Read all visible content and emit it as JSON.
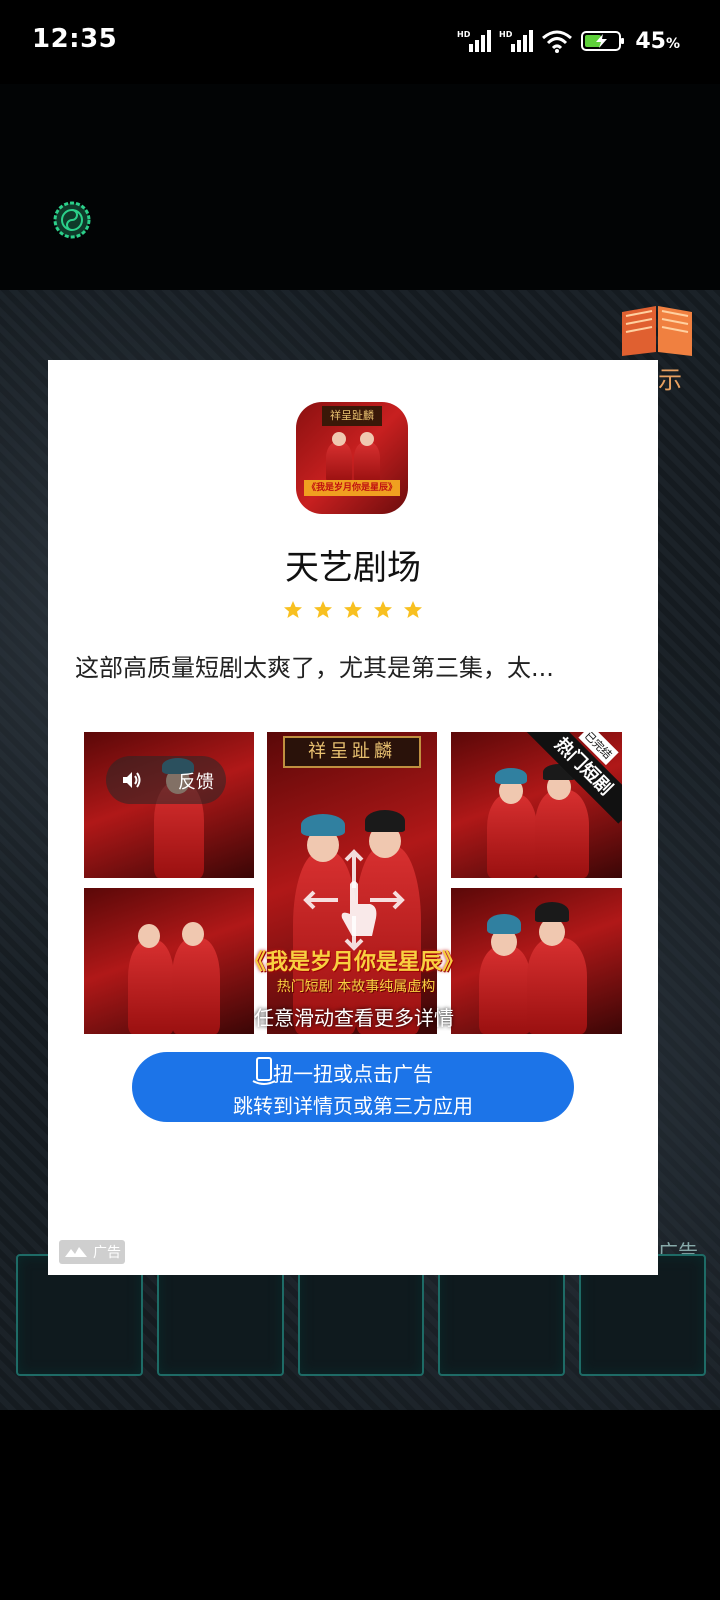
{
  "status_bar": {
    "time": "12:35",
    "battery_percent": "45",
    "battery_unit": "%",
    "signal_labels": [
      "HD",
      "HD"
    ]
  },
  "game": {
    "side_char": "示",
    "ad_side_label": "广告"
  },
  "ad": {
    "app_name": "天艺剧场",
    "rating_stars": 5,
    "description": "这部高质量短剧太爽了，尤其是第三集，太...",
    "app_icon": {
      "sign_text": "祥呈趾麟",
      "banner_text": "《我是岁月你是星辰》"
    },
    "gallery": {
      "plaque_text": "祥呈趾麟",
      "feedback_label": "反馈",
      "hot_ribbon": "热门短剧",
      "done_tag": "已完结",
      "drama_title": "《我是岁月你是星辰》",
      "drama_subtitle": "热门短剧  本故事纯属虚构",
      "swipe_hint": "任意滑动查看更多详情"
    },
    "cta": {
      "line1": "扭一扭或点击广告",
      "line2": "跳转到详情页或第三方应用"
    },
    "badge_label": "广告"
  },
  "colors": {
    "cta_blue": "#1c74e8",
    "star_yellow": "#f8c020",
    "game_teal": "#1e6b66"
  }
}
